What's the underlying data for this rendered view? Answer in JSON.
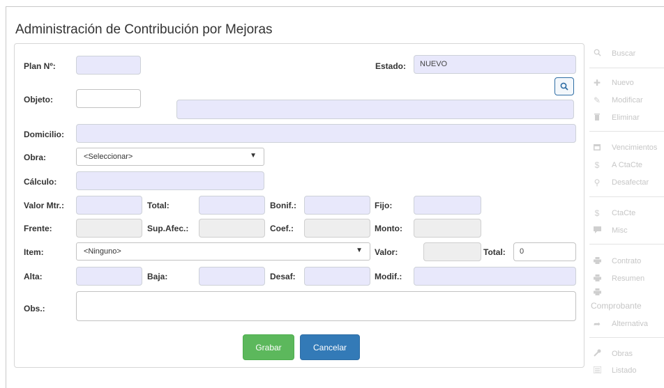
{
  "title": "Administración de Contribución por Mejoras",
  "form": {
    "plan_label": "Plan Nº:",
    "plan_value": "",
    "estado_label": "Estado:",
    "estado_value": "NUEVO",
    "objeto_label": "Objeto:",
    "objeto_value": "",
    "objeto_desc": "",
    "domicilio_label": "Domicilio:",
    "domicilio_value": "",
    "obra_label": "Obra:",
    "obra_selected": "<Seleccionar>",
    "calculo_label": "Cálculo:",
    "calculo_value": "",
    "valor_mtr_label": "Valor Mtr.:",
    "total_label": "Total:",
    "bonif_label": "Bonif.:",
    "fijo_label": "Fijo:",
    "frente_label": "Frente:",
    "sup_afec_label": "Sup.Afec.:",
    "coef_label": "Coef.:",
    "monto_label": "Monto:",
    "item_label": "Item:",
    "item_selected": "<Ninguno>",
    "valor_label": "Valor:",
    "item_total_label": "Total:",
    "item_total_value": "0",
    "alta_label": "Alta:",
    "baja_label": "Baja:",
    "desaf_label": "Desaf:",
    "modif_label": "Modif.:",
    "obs_label": "Obs.:",
    "obs_value": ""
  },
  "buttons": {
    "grabar": "Grabar",
    "cancelar": "Cancelar"
  },
  "sidebar": {
    "items": [
      {
        "label": "Buscar",
        "icon": "search-icon"
      },
      {
        "label": "Nuevo",
        "icon": "plus-icon"
      },
      {
        "label": "Modificar",
        "icon": "pencil-icon"
      },
      {
        "label": "Eliminar",
        "icon": "trash-icon"
      },
      {
        "label": "Vencimientos",
        "icon": "calendar-icon"
      },
      {
        "label": "A CtaCte",
        "icon": "dollar-icon"
      },
      {
        "label": "Desafectar",
        "icon": "link-icon"
      },
      {
        "label": "CtaCte",
        "icon": "dollar-icon"
      },
      {
        "label": "Misc",
        "icon": "comment-icon"
      },
      {
        "label": "Contrato",
        "icon": "print-icon"
      },
      {
        "label": "Resumen",
        "icon": "print-icon"
      },
      {
        "label": "Comprobante",
        "icon": "print-icon"
      },
      {
        "label": "Alternativa",
        "icon": "share-icon"
      },
      {
        "label": "Obras",
        "icon": "wrench-icon"
      },
      {
        "label": "Listado",
        "icon": "list-icon"
      }
    ]
  }
}
